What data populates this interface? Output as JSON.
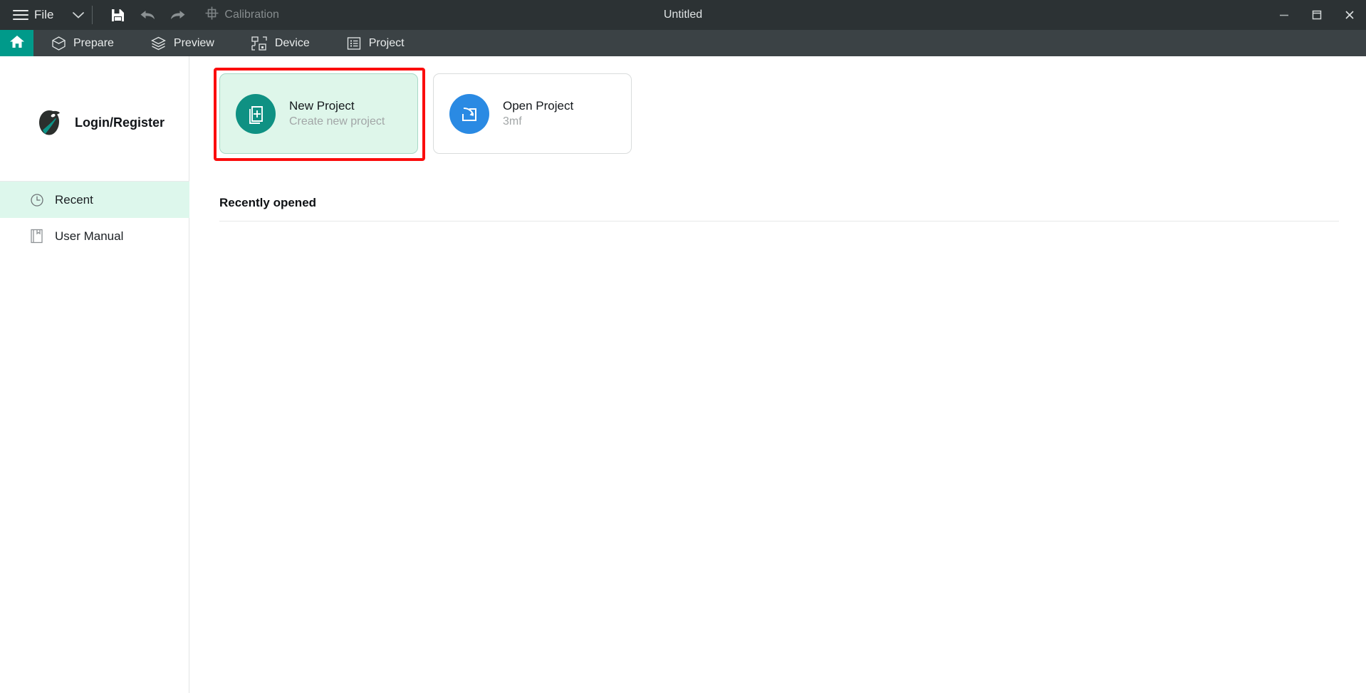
{
  "titlebar": {
    "menu_label": "File",
    "menu_icon": "hamburger-icon",
    "dropdown_icon": "chevron-down-icon",
    "save_icon": "save-disk-icon",
    "undo_icon": "undo-arrow-icon",
    "redo_icon": "redo-arrow-icon",
    "calibration_label": "Calibration",
    "calibration_icon": "calibration-target-icon",
    "window_title": "Untitled",
    "minimize_icon": "minimize-icon",
    "maximize_icon": "maximize-icon",
    "close_icon": "close-icon"
  },
  "tabs": {
    "home_icon": "home-icon",
    "items": [
      {
        "label": "Prepare",
        "icon": "cube-icon"
      },
      {
        "label": "Preview",
        "icon": "layers-icon"
      },
      {
        "label": "Device",
        "icon": "device-printer-icon"
      },
      {
        "label": "Project",
        "icon": "list-icon"
      }
    ]
  },
  "sidebar": {
    "account_label": "Login/Register",
    "account_icon": "bambu-bird-avatar",
    "items": [
      {
        "label": "Recent",
        "icon": "clock-icon",
        "active": true
      },
      {
        "label": "User Manual",
        "icon": "book-icon",
        "active": false
      }
    ]
  },
  "main": {
    "cards": [
      {
        "title": "New Project",
        "subtitle": "Create new project",
        "icon": "new-document-plus-icon",
        "selected": true,
        "highlighted": true
      },
      {
        "title": "Open Project",
        "subtitle": "3mf",
        "icon": "open-folder-arrow-icon",
        "selected": false,
        "highlighted": false
      }
    ],
    "recent_section_title": "Recently opened",
    "recent_items": []
  },
  "colors": {
    "titlebar_bg": "#2c3234",
    "tabbar_bg": "#3b4245",
    "accent_teal": "#009a8a",
    "card_selected_bg": "#def6ea",
    "sidebar_active_bg": "#ddf7ec",
    "highlight_red": "#fb0d0d",
    "icon_blue": "#2a8ae3",
    "icon_teal": "#0f9183"
  }
}
